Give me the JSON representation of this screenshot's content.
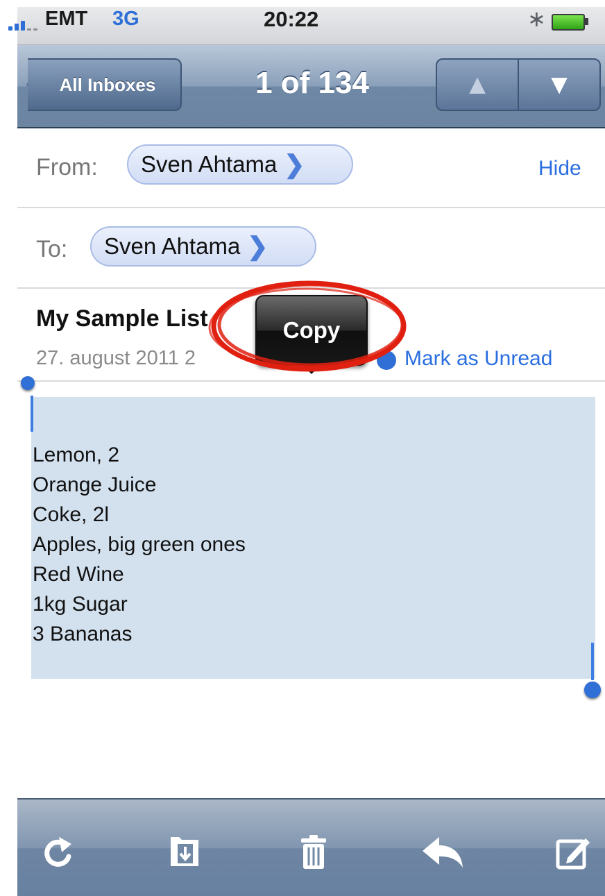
{
  "status_bar": {
    "carrier": "EMT",
    "network": "3G",
    "time": "20:22"
  },
  "nav_bar": {
    "back_label": "All Inboxes",
    "title": "1 of 134",
    "prev_icon": "up-arrow-icon",
    "next_icon": "down-arrow-icon"
  },
  "header": {
    "from_label": "From:",
    "from_name": "Sven Ahtama",
    "hide_label": "Hide",
    "to_label": "To:",
    "to_name": "Sven Ahtama"
  },
  "message": {
    "subject": "My Sample List",
    "date": "27. august 2011 2",
    "mark_unread_label": "Mark as Unread",
    "body_lines": [
      "Lemon, 2",
      "Orange Juice",
      "Coke, 2l",
      "Apples, big green ones",
      "Red Wine",
      "1kg Sugar",
      "3 Bananas"
    ]
  },
  "popup": {
    "copy_label": "Copy"
  },
  "toolbar": {
    "icons": [
      "refresh-icon",
      "move-to-folder-icon",
      "trash-icon",
      "reply-icon",
      "compose-icon"
    ]
  },
  "colors": {
    "accent": "#2a6ee0",
    "selection": "#d3e1ef",
    "annotation": "#e02010"
  }
}
